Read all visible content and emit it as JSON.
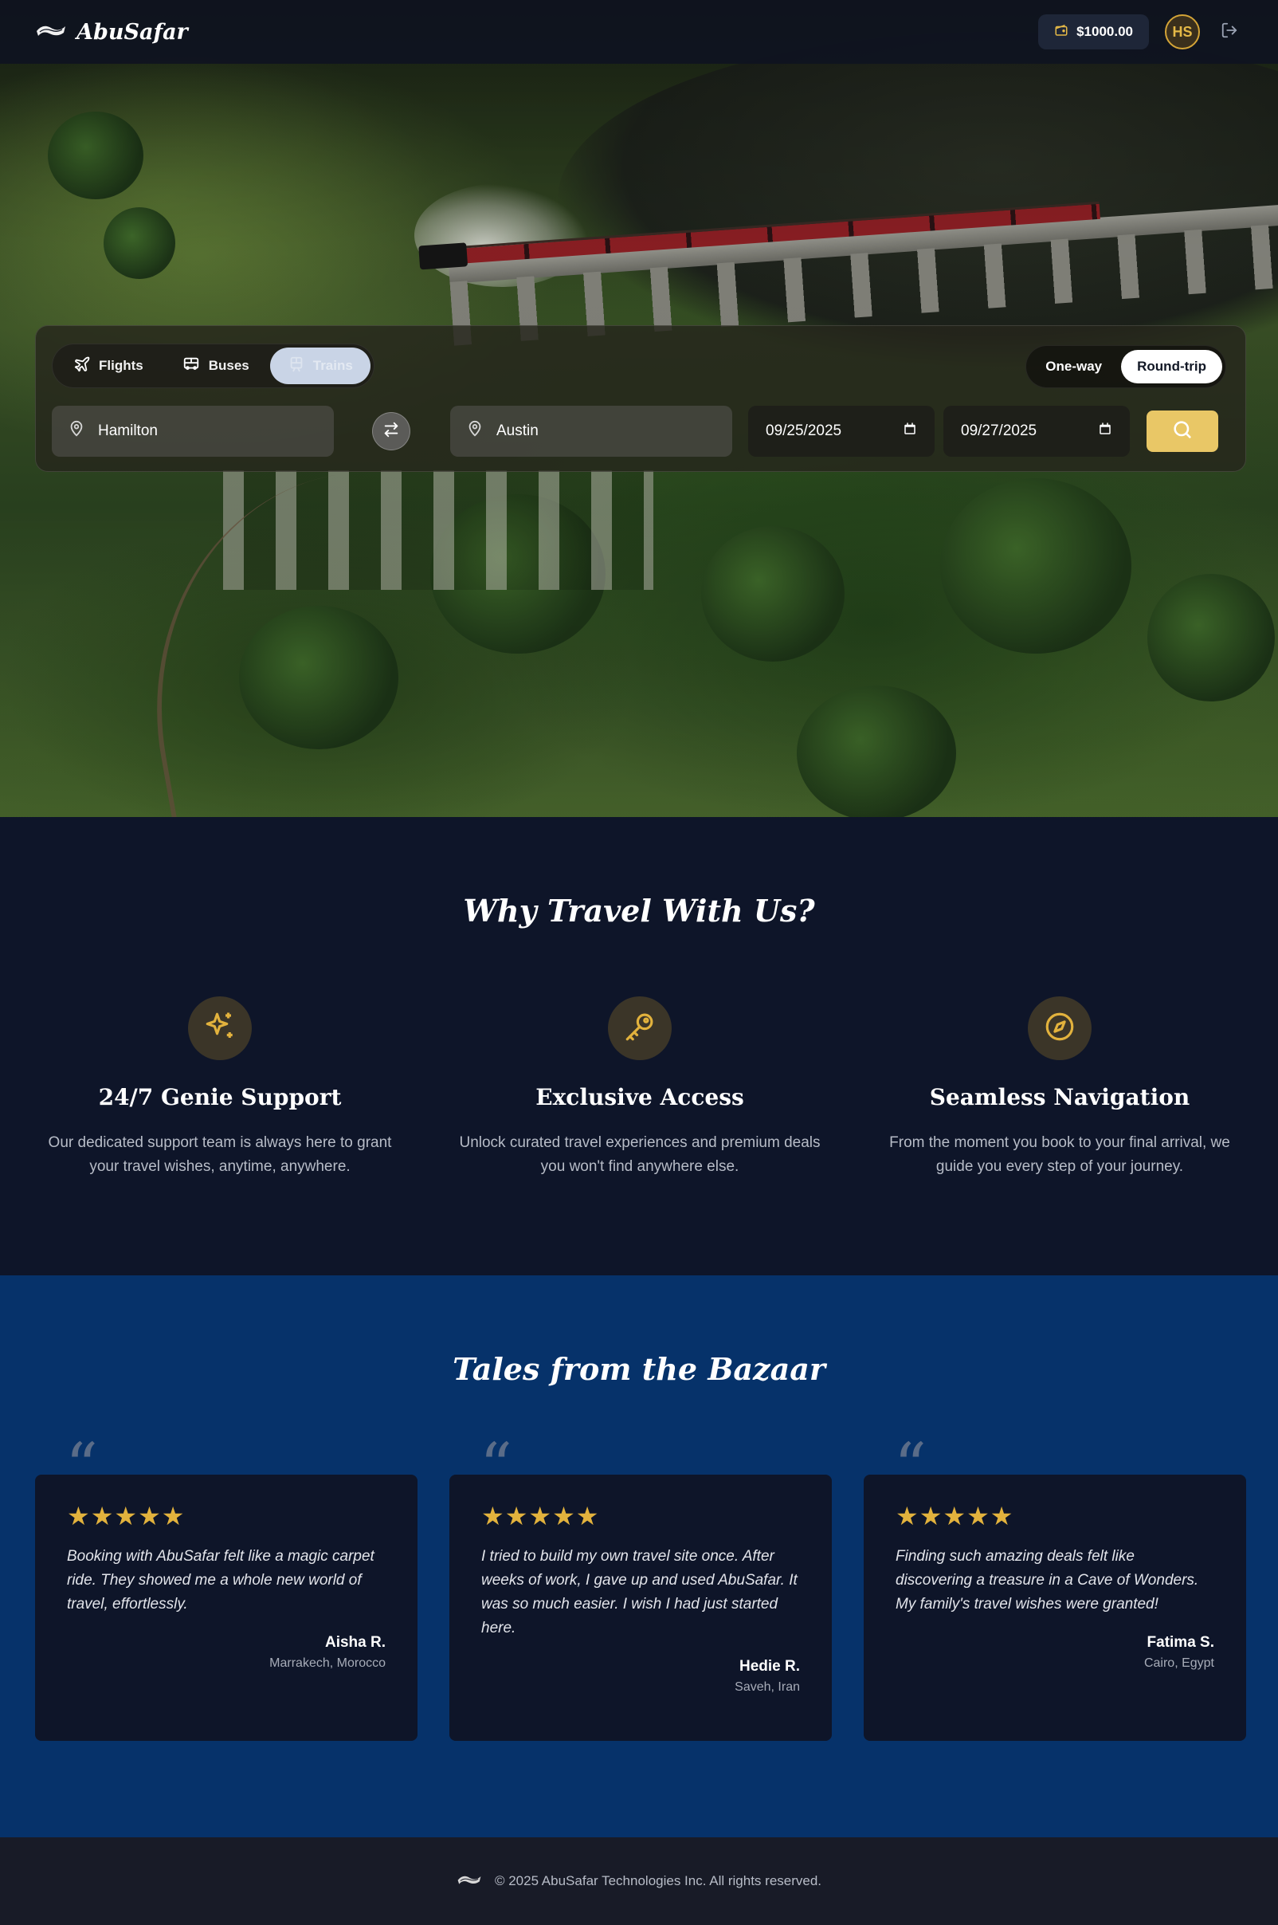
{
  "header": {
    "brand": "AbuSafar",
    "wallet_balance": "$1000.00",
    "user_initials": "HS",
    "logo_icon": "magic-carpet-icon",
    "wallet_icon": "wallet-icon",
    "logout_icon": "logout-icon"
  },
  "search": {
    "modes": [
      {
        "label": "Flights",
        "icon": "plane-icon"
      },
      {
        "label": "Buses",
        "icon": "bus-icon"
      },
      {
        "label": "Trains",
        "icon": "train-icon",
        "active": true
      }
    ],
    "trip_types": [
      {
        "label": "One-way"
      },
      {
        "label": "Round-trip",
        "active": true
      }
    ],
    "origin": "Hamilton",
    "destination": "Austin",
    "depart_date": "09/25/2025",
    "return_date": "09/27/2025"
  },
  "features": {
    "title": "Why Travel With Us?",
    "items": [
      {
        "title": "24/7 Genie Support",
        "desc": "Our dedicated support team is always here to grant your travel wishes, anytime, anywhere.",
        "icon": "sparkles-icon"
      },
      {
        "title": "Exclusive Access",
        "desc": "Unlock curated travel experiences and premium deals you won't find anywhere else.",
        "icon": "key-icon"
      },
      {
        "title": "Seamless Navigation",
        "desc": "From the moment you book to your final arrival, we guide you every step of your journey.",
        "icon": "compass-icon"
      }
    ]
  },
  "testimonials": {
    "title": "Tales from the Bazaar",
    "items": [
      {
        "stars": "★★★★★",
        "text": "Booking with AbuSafar felt like a magic carpet ride. They showed me a whole new world of travel, effortlessly.",
        "author": "Aisha R.",
        "location": "Marrakech, Morocco"
      },
      {
        "stars": "★★★★★",
        "text": "I tried to build my own travel site once. After weeks of work, I gave up and used AbuSafar. It was so much easier. I wish I had just started here.",
        "author": "Hedie R.",
        "location": "Saveh, Iran"
      },
      {
        "stars": "★★★★★",
        "text": "Finding such amazing deals felt like discovering a treasure in a Cave of Wonders. My family's travel wishes were granted!",
        "author": "Fatima S.",
        "location": "Cairo, Egypt"
      }
    ]
  },
  "footer": {
    "copyright": "© 2025 AbuSafar Technologies Inc. All rights reserved."
  },
  "colors": {
    "accent_gold": "#e9c766",
    "navy": "#0e1529",
    "testimonial_bg": "#06326a"
  }
}
